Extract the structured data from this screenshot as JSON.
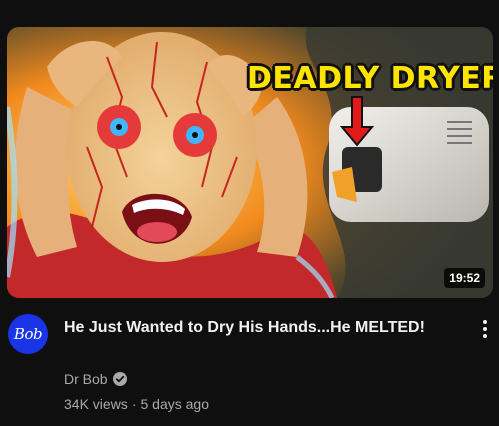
{
  "video": {
    "thumbnail_text": "DEADLY DRYER",
    "duration": "19:52",
    "title": "He Just Wanted to Dry His Hands...He MELTED!",
    "channel": "Dr Bob",
    "views": "34K views",
    "separator": "·",
    "age": "5 days ago"
  },
  "avatar": {
    "text": "Bob",
    "background": "#1a35e8"
  },
  "icons": {
    "verified": "verified-check-icon",
    "more": "vertical-ellipsis-icon"
  },
  "colors": {
    "background": "#0f0f0f",
    "title_text": "#f1f1f1",
    "secondary_text": "#aaaaaa",
    "thumbnail_title": "#ffe400"
  }
}
